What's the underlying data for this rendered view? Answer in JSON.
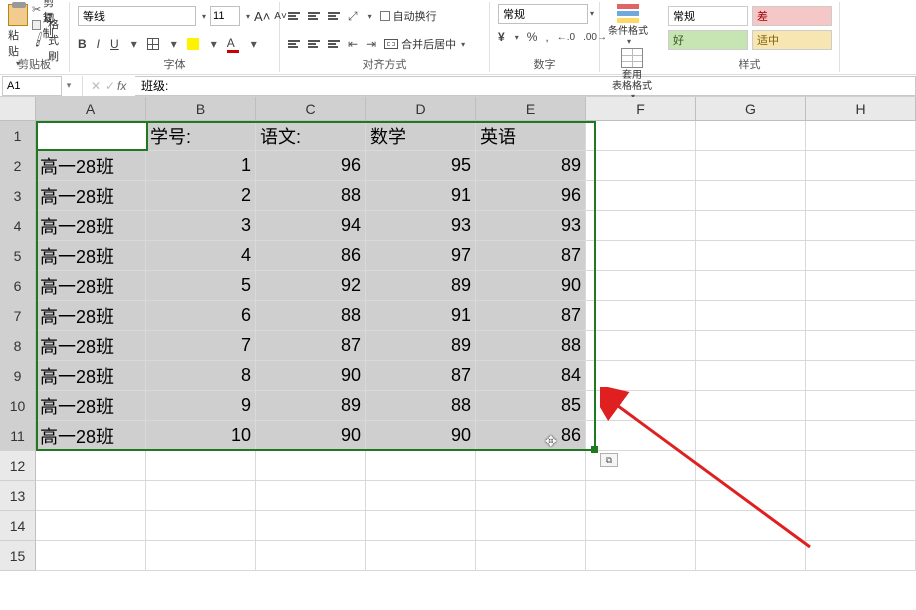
{
  "ribbon": {
    "clipboard": {
      "paste": "粘贴",
      "cut": "剪切",
      "copy": "复制",
      "brush": "格式刷",
      "group_label": "剪贴板"
    },
    "font": {
      "font_name": "等线",
      "font_size": "11",
      "group_label": "字体",
      "bold": "B",
      "italic": "I",
      "underline": "U",
      "fontcolor_letter": "A"
    },
    "align": {
      "wrap": "自动换行",
      "merge": "合并后居中",
      "group_label": "对齐方式"
    },
    "number": {
      "format": "常规",
      "currency": "¥",
      "percent": "%",
      "comma": ",",
      "dec_inc": "←.0",
      "dec_dec": ".00→",
      "group_label": "数字"
    },
    "styles": {
      "cond": "条件格式",
      "table": "套用\n表格格式",
      "group_label": "样式",
      "gallery": {
        "normal": "常规",
        "bad": "差",
        "good": "好",
        "neutral": "适中"
      }
    }
  },
  "formula_bar": {
    "name_box": "A1",
    "fx": "fx",
    "formula": "班级:"
  },
  "columns": [
    "A",
    "B",
    "C",
    "D",
    "E",
    "F",
    "G",
    "H"
  ],
  "rows": [
    "1",
    "2",
    "3",
    "4",
    "5",
    "6",
    "7",
    "8",
    "9",
    "10",
    "11",
    "12",
    "13",
    "14",
    "15"
  ],
  "selected_cols": 5,
  "selected_rows": 11,
  "table": {
    "headers": [
      "班级:",
      "学号:",
      "语文:",
      "数学",
      "英语"
    ],
    "data": [
      [
        "高一28班",
        "1",
        "96",
        "95",
        "89"
      ],
      [
        "高一28班",
        "2",
        "88",
        "91",
        "96"
      ],
      [
        "高一28班",
        "3",
        "94",
        "93",
        "93"
      ],
      [
        "高一28班",
        "4",
        "86",
        "97",
        "87"
      ],
      [
        "高一28班",
        "5",
        "92",
        "89",
        "90"
      ],
      [
        "高一28班",
        "6",
        "88",
        "91",
        "87"
      ],
      [
        "高一28班",
        "7",
        "87",
        "89",
        "88"
      ],
      [
        "高一28班",
        "8",
        "90",
        "87",
        "84"
      ],
      [
        "高一28班",
        "9",
        "89",
        "88",
        "85"
      ],
      [
        "高一28班",
        "10",
        "90",
        "90",
        "86"
      ]
    ]
  },
  "chart_data": {
    "type": "table",
    "title": "",
    "columns": [
      "班级",
      "学号",
      "语文",
      "数学",
      "英语"
    ],
    "rows": [
      [
        "高一28班",
        1,
        96,
        95,
        89
      ],
      [
        "高一28班",
        2,
        88,
        91,
        96
      ],
      [
        "高一28班",
        3,
        94,
        93,
        93
      ],
      [
        "高一28班",
        4,
        86,
        97,
        87
      ],
      [
        "高一28班",
        5,
        92,
        89,
        90
      ],
      [
        "高一28班",
        6,
        88,
        91,
        87
      ],
      [
        "高一28班",
        7,
        87,
        89,
        88
      ],
      [
        "高一28班",
        8,
        90,
        87,
        84
      ],
      [
        "高一28班",
        9,
        89,
        88,
        85
      ],
      [
        "高一28班",
        10,
        90,
        90,
        86
      ]
    ]
  }
}
